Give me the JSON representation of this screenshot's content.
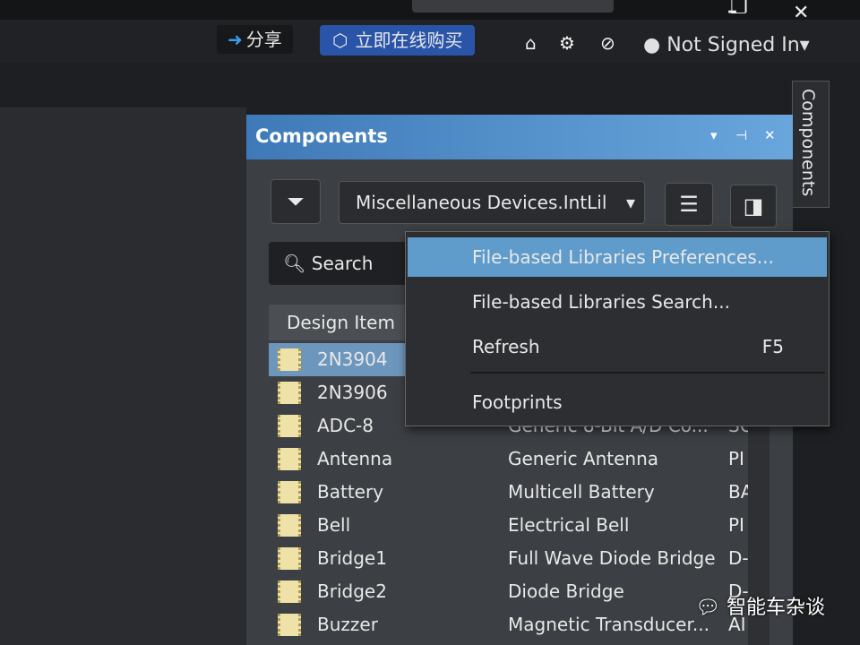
{
  "top": {
    "minimize": "–",
    "restore": "❐",
    "close": "✕"
  },
  "toolbar": {
    "share": "分享",
    "buy": "立即在线购买",
    "home_icon": "home-icon",
    "settings_icon": "gear-icon",
    "notify_icon": "bell-off-icon",
    "user": "Not Signed In",
    "user_caret": "▾"
  },
  "panel": {
    "title": "Components",
    "side_tab": "Components",
    "ctrl_menu": "▾",
    "ctrl_pin": "⊣",
    "ctrl_close": "✕",
    "library": "Miscellaneous Devices.IntLil",
    "library_caret": "▾",
    "search_placeholder": "Search",
    "columns": [
      "Design Item"
    ]
  },
  "menu": {
    "items": [
      {
        "label": "File-based Libraries Preferences...",
        "shortcut": ""
      },
      {
        "label": "File-based Libraries Search...",
        "shortcut": ""
      },
      {
        "label": "Refresh",
        "shortcut": "F5"
      },
      {
        "label": "Footprints",
        "shortcut": ""
      }
    ]
  },
  "rows": [
    {
      "name": "2N3904",
      "desc": "",
      "lib": ""
    },
    {
      "name": "2N3906",
      "desc": "",
      "lib": ""
    },
    {
      "name": "ADC-8",
      "desc": "Generic 8-Bit A/D Co...",
      "lib": "SO"
    },
    {
      "name": "Antenna",
      "desc": "Generic Antenna",
      "lib": "PI"
    },
    {
      "name": "Battery",
      "desc": "Multicell Battery",
      "lib": "BA"
    },
    {
      "name": "Bell",
      "desc": "Electrical Bell",
      "lib": "PI"
    },
    {
      "name": "Bridge1",
      "desc": "Full Wave Diode Bridge",
      "lib": "D-"
    },
    {
      "name": "Bridge2",
      "desc": "Diode Bridge",
      "lib": "D-"
    },
    {
      "name": "Buzzer",
      "desc": "Magnetic Transducer...",
      "lib": "AI"
    }
  ],
  "watermark": "智能车杂谈",
  "colors": {
    "title_bar": "#3f7ab8",
    "highlight": "#5f9ccc",
    "selected_row": "#6d96bd",
    "buy_button": "#2a54a8"
  }
}
